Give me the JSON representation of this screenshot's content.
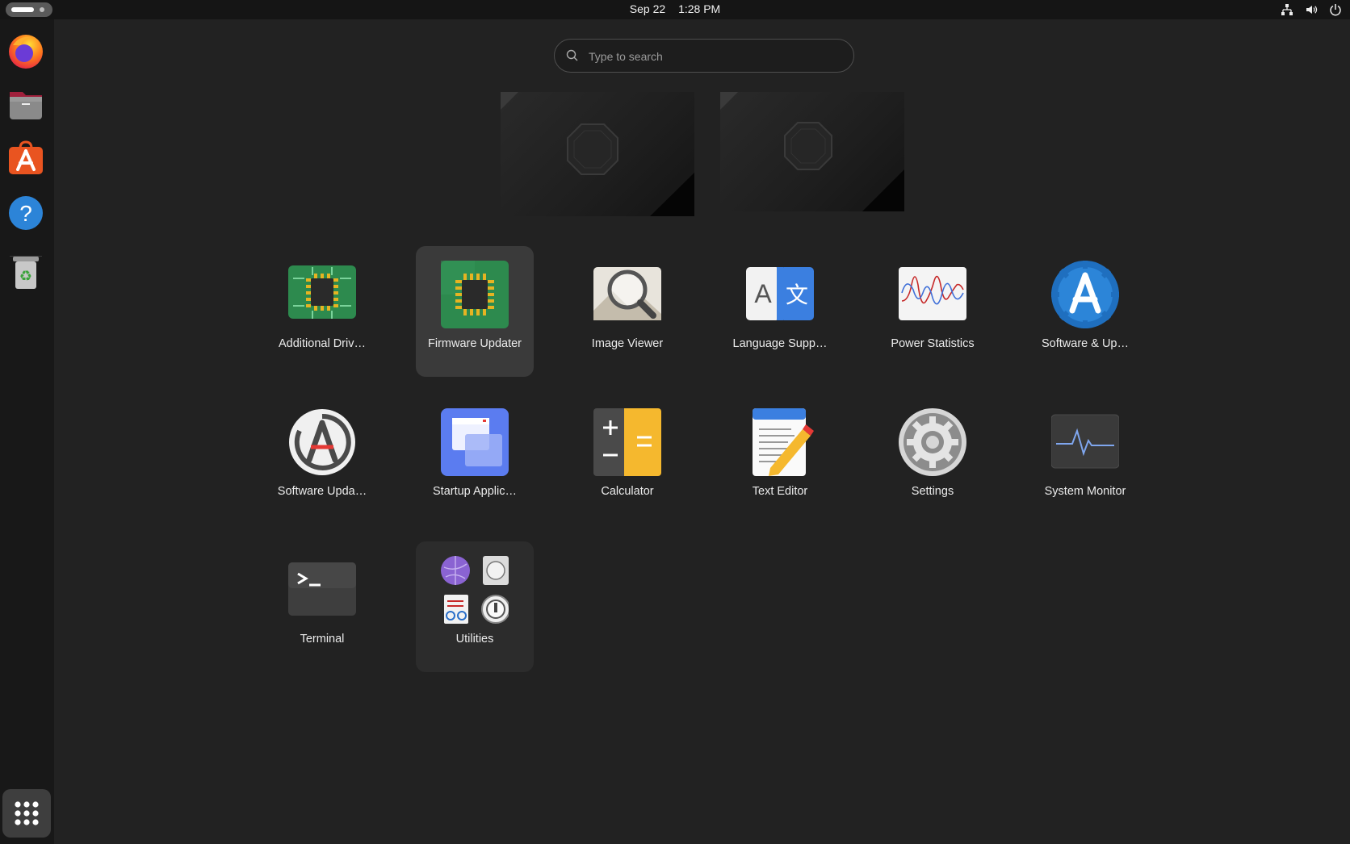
{
  "topbar": {
    "date": "Sep 22",
    "time": "1:28 PM",
    "tray_icons": [
      "network-icon",
      "volume-icon",
      "power-icon"
    ]
  },
  "dock": {
    "items": [
      "firefox-icon",
      "files-icon",
      "app-center-icon",
      "help-icon",
      "trash-icon"
    ],
    "show_apps_icon": "grid-icon"
  },
  "search": {
    "placeholder": "Type to search",
    "value": ""
  },
  "apps": [
    {
      "label": "Additional Driv…",
      "icon": "chip-icon"
    },
    {
      "label": "Firmware Updater",
      "icon": "chip-icon",
      "selected": true
    },
    {
      "label": "Image Viewer",
      "icon": "image-viewer-icon"
    },
    {
      "label": "Language Supp…",
      "icon": "language-icon"
    },
    {
      "label": "Power Statistics",
      "icon": "power-stats-icon"
    },
    {
      "label": "Software & Up…",
      "icon": "software-sources-icon"
    },
    {
      "label": "Software Upda…",
      "icon": "software-updater-icon"
    },
    {
      "label": "Startup Applic…",
      "icon": "startup-apps-icon"
    },
    {
      "label": "Calculator",
      "icon": "calculator-icon"
    },
    {
      "label": "Text Editor",
      "icon": "text-editor-icon"
    },
    {
      "label": "Settings",
      "icon": "gear-icon"
    },
    {
      "label": "System Monitor",
      "icon": "system-monitor-icon"
    },
    {
      "label": "Terminal",
      "icon": "terminal-icon"
    },
    {
      "label": "Utilities",
      "icon": "folder-icon",
      "folder": true
    }
  ],
  "colors": {
    "background": "#222222",
    "topbar": "#151515",
    "dock": "#181818",
    "selection": "#3a3a3a"
  }
}
